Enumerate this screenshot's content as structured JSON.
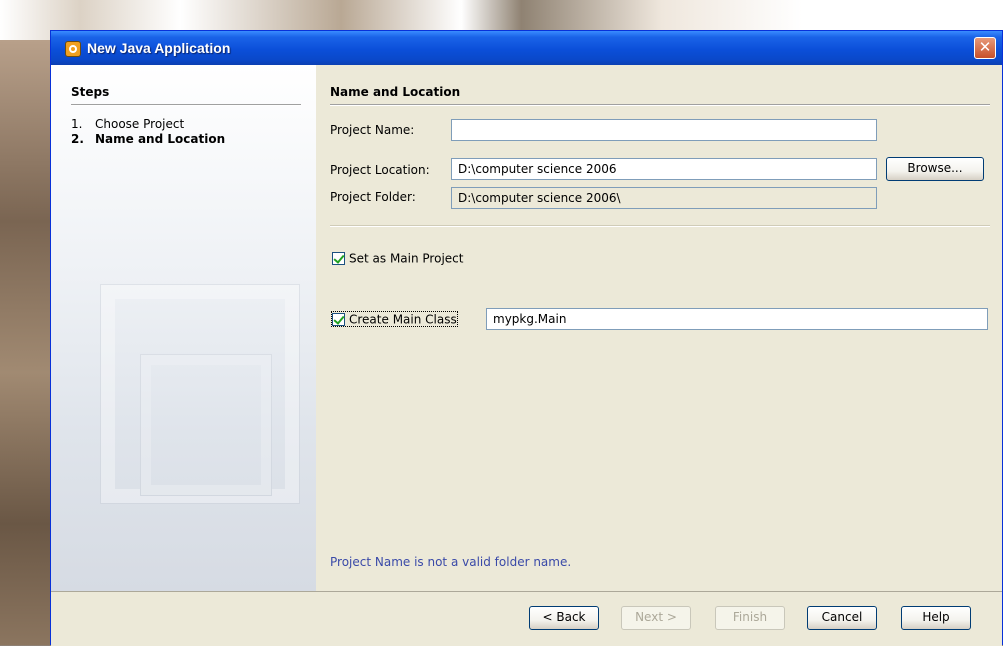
{
  "window": {
    "title": "New Java Application",
    "close_symbol": "✕"
  },
  "steps": {
    "title": "Steps",
    "items": [
      {
        "num": "1.",
        "label": "Choose Project"
      },
      {
        "num": "2.",
        "label": "Name and Location"
      }
    ]
  },
  "panel": {
    "title": "Name and Location",
    "project_name_label": "Project Name:",
    "project_name_value": "",
    "project_location_label": "Project Location:",
    "project_location_value": "D:\\computer science 2006",
    "browse_label": "Browse...",
    "project_folder_label": "Project Folder:",
    "project_folder_value": "D:\\computer science 2006\\",
    "set_main_project_label": "Set as Main Project",
    "create_main_class_label": "Create Main Class",
    "main_class_value": "mypkg.Main",
    "error_message": "Project Name is not a valid folder name."
  },
  "footer": {
    "back_label": "< Back",
    "next_label": "Next >",
    "finish_label": "Finish",
    "cancel_label": "Cancel",
    "help_label": "Help"
  },
  "colors": {
    "title_bar": "#0b4fd9",
    "dialog_bg": "#ece9d8",
    "error_text": "#3a4aa8"
  }
}
